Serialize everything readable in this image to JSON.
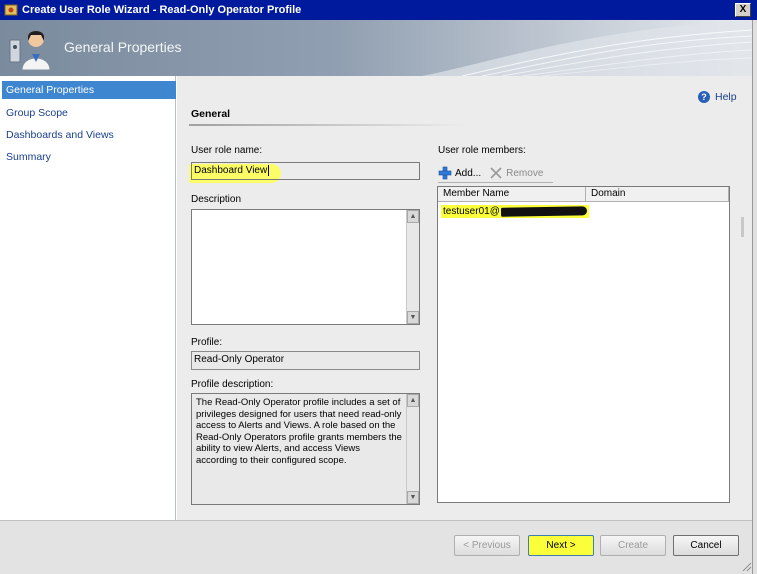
{
  "window": {
    "title": "Create User Role Wizard - Read-Only Operator Profile",
    "close_label": "X"
  },
  "header": {
    "title": "General Properties"
  },
  "nav": {
    "items": [
      {
        "label": "General Properties",
        "selected": true
      },
      {
        "label": "Group Scope",
        "selected": false
      },
      {
        "label": "Dashboards and Views",
        "selected": false
      },
      {
        "label": "Summary",
        "selected": false
      }
    ]
  },
  "help": {
    "label": "Help"
  },
  "section": {
    "title": "General"
  },
  "form": {
    "role_name_label": "User role name:",
    "role_name_value": "Dashboard View",
    "description_label": "Description",
    "description_value": "",
    "profile_label": "Profile:",
    "profile_value": "Read-Only Operator",
    "profile_description_label": "Profile description:",
    "profile_description_value": "The Read-Only Operator profile includes a set of privileges designed for users that need read-only access to Alerts and Views. A role based on the Read-Only Operators profile grants members the ability to view Alerts, and access Views according to their configured scope."
  },
  "members": {
    "label": "User role members:",
    "add_label": "Add...",
    "remove_label": "Remove",
    "columns": [
      "Member Name",
      "Domain"
    ],
    "rows": [
      {
        "member_name": "testuser01@",
        "domain": ""
      }
    ]
  },
  "footer": {
    "previous_label": "< Previous",
    "next_label": "Next >",
    "create_label": "Create",
    "cancel_label": "Cancel"
  },
  "colors": {
    "titlebar": "#001a9e",
    "nav_selected": "#3e86d0",
    "highlight": "#fbff3a"
  }
}
